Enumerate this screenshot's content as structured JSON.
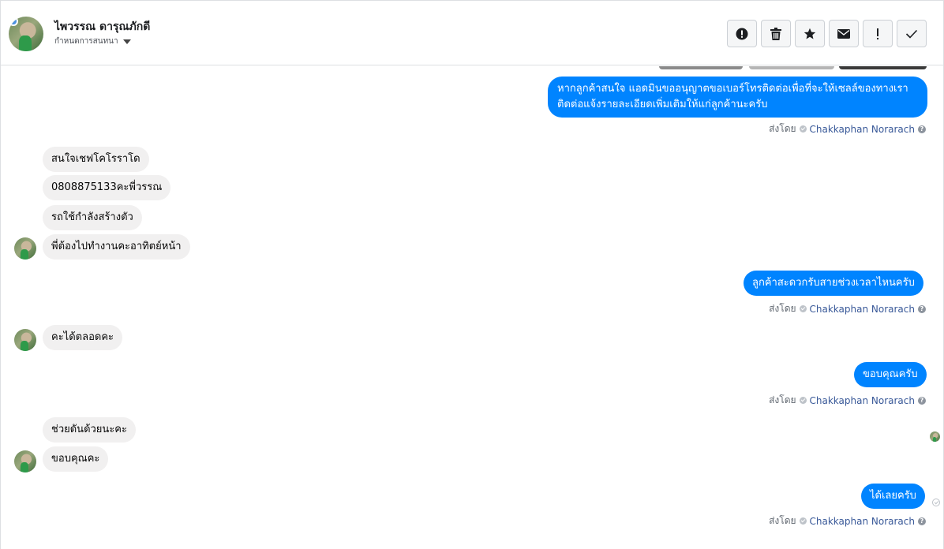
{
  "header": {
    "contact_name": "ไพวรรณ ดารุณภักดี",
    "status_label": "กำหนดการสนทนา"
  },
  "toolbar": {
    "buttons": [
      {
        "icon": "alert-circle-icon"
      },
      {
        "icon": "trash-icon"
      },
      {
        "icon": "star-icon"
      },
      {
        "icon": "envelope-icon"
      },
      {
        "icon": "exclamation-icon"
      },
      {
        "icon": "checkmark-icon"
      }
    ]
  },
  "sent_by": {
    "prefix": "ส่งโดย",
    "author": "Chakkaphan Norarach",
    "help": "?"
  },
  "messages": {
    "m1": "หากลูกค้าสนใจ แอดมินขออนุญาตขอเบอร์โทรติดต่อเพื่อที่จะให้เซลล์ของทางเราติดต่อแจ้งรายละเอียดเพิ่มเติมให้แก่ลูกค้านะครับ",
    "m2": "สนใจเชฟโคโรราโด",
    "m3": "0808875133คะพี่วรรณ",
    "m4": "รถใช้กำลังสร้างตัว",
    "m5": "พี่ต้องไปทำงานคะอาทิตย์หน้า",
    "m6": "ลูกค้าสะดวกรับสายช่วงเวลาไหนครับ",
    "m7": "คะได้ตลอดคะ",
    "m8": "ขอบคุณครับ",
    "m9": "ช่วยดันด้วยนะคะ",
    "m10": "ขอบคุณคะ",
    "m11": "ได้เลยครับ"
  },
  "colors": {
    "outgoing_bubble": "#0084ff",
    "incoming_bubble": "#f1f0f0",
    "author_link": "#385898"
  }
}
